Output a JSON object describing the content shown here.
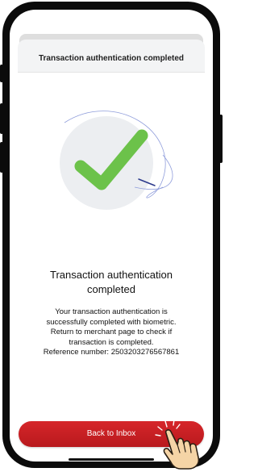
{
  "header": {
    "title": "Transaction authentication completed"
  },
  "illustration": {
    "icon": "check-icon",
    "accent": "#6cc24a",
    "circle": "#eceef1"
  },
  "content": {
    "title_line1": "Transaction authentication",
    "title_line2": "completed",
    "body_lines": [
      "Your transaction authentication is",
      "successfully completed with biometric.",
      "Return to merchant page to check if",
      "transaction is completed.",
      "Reference number: 2503203276567861"
    ]
  },
  "actions": {
    "back_label": "Back to Inbox",
    "button_color": "#c8202a"
  },
  "overlay": {
    "icon": "tap-hand-icon"
  }
}
